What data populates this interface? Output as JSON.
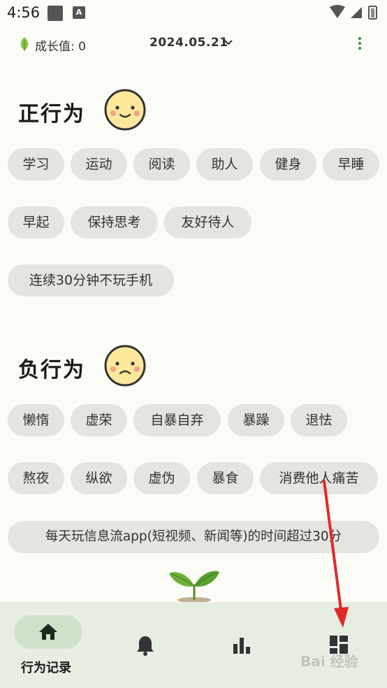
{
  "status_bar": {
    "time": "4:56"
  },
  "header": {
    "growth_label": "成长值: 0",
    "date": "2024.05.21"
  },
  "positive": {
    "title": "正行为",
    "chips": [
      "学习",
      "运动",
      "阅读",
      "助人",
      "健身",
      "早睡",
      "早起",
      "保持思考",
      "友好待人",
      "连续30分钟不玩手机"
    ]
  },
  "negative": {
    "title": "负行为",
    "chips": [
      "懒惰",
      "虚荣",
      "自暴自弃",
      "暴躁",
      "退怯",
      "熬夜",
      "纵欲",
      "虚伪",
      "暴食",
      "消费他人痛苦",
      "每天玩信息流app(短视频、新闻等)的时间超过30分"
    ]
  },
  "bottom_nav": {
    "active_label": "行为记录",
    "items": [
      "home-icon",
      "bell-icon",
      "bar-chart-icon",
      "dashboard-icon"
    ]
  },
  "watermark": "Bai 经验",
  "colors": {
    "accent": "#2c8f3c",
    "chip_bg": "#e4e5df",
    "nav_bg": "#e6eee2",
    "annotation": "#e02a2a"
  }
}
